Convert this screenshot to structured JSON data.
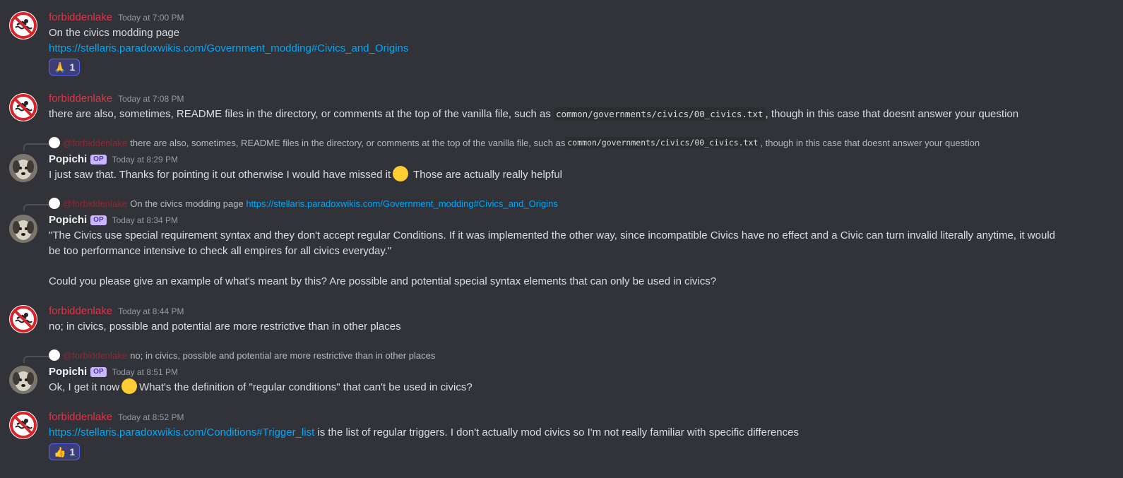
{
  "messages": [
    {
      "author": "forbiddenlake",
      "timestamp": "Today at 7:00 PM",
      "lines": [
        "On the civics modding page"
      ],
      "link": "https://stellaris.paradoxwikis.com/Government_modding#Civics_and_Origins",
      "reaction": {
        "emoji": "🙏",
        "count": "1"
      }
    },
    {
      "author": "forbiddenlake",
      "timestamp": "Today at 7:08 PM",
      "text_before": "there are also, sometimes, README files in the directory, or comments at the top of the  vanilla file, such as ",
      "code": "common/governments/civics/00_civics.txt",
      "text_after": ", though in this case that doesnt answer your question"
    },
    {
      "reply": {
        "author": "@forbiddenlake",
        "text_before": "there are also, sometimes, README files in the directory, or comments at the top of the  vanilla file, such as ",
        "code": "common/governments/civics/00_civics.txt",
        "text_after": ", though in this case that doesnt answer your question"
      },
      "author": "Popichi",
      "badge": "OP",
      "timestamp": "Today at 8:29 PM",
      "text_before": "I just saw that. Thanks for pointing it out otherwise I would have missed it",
      "text_after": "Those are actually really helpful"
    },
    {
      "reply": {
        "author": "@forbiddenlake",
        "text": "On the civics modding page",
        "link": "https://stellaris.paradoxwikis.com/Government_modding#Civics_and_Origins"
      },
      "author": "Popichi",
      "badge": "OP",
      "timestamp": "Today at 8:34 PM",
      "line1": "\"The Civics use special requirement syntax and they don't accept regular Conditions. If it was implemented the other way, since incompatible Civics have no effect and a Civic can turn invalid literally anytime, it would",
      "line2": "be too performance intensive to check all empires for all civics everyday.\"",
      "line3": "Could you please give an example of what's meant by this? Are possible and potential special syntax elements that can only be used in civics?"
    },
    {
      "author": "forbiddenlake",
      "timestamp": "Today at 8:44 PM",
      "text": "no; in civics, possible and potential are more restrictive than in other places"
    },
    {
      "reply": {
        "author": "@forbiddenlake",
        "text": "no; in civics, possible and potential are more restrictive than in other places"
      },
      "author": "Popichi",
      "badge": "OP",
      "timestamp": "Today at 8:51 PM",
      "text_before": "Ok, I get it now",
      "text_after": "What's the definition of \"regular conditions\" that can't be used in civics?"
    },
    {
      "author": "forbiddenlake",
      "timestamp": "Today at 8:52 PM",
      "link": "https://stellaris.paradoxwikis.com/Conditions#Trigger_list",
      "text_after": " is the list of regular triggers. I don't actually mod civics so I'm not really familiar with specific differences",
      "reaction": {
        "emoji": "👍",
        "count": "1"
      }
    }
  ]
}
